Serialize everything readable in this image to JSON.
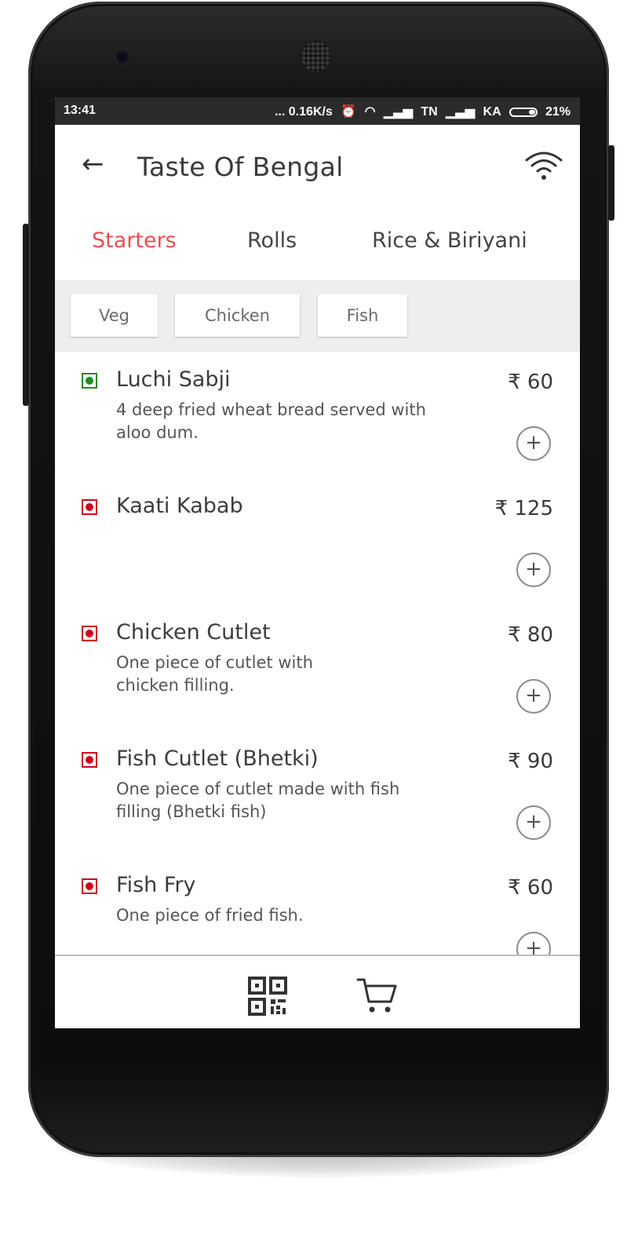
{
  "status_bar": {
    "time": "13:41",
    "speed": "... 0.16K/s",
    "alarm_icon": "alarm-icon",
    "carrier1": "TN",
    "carrier2": "KA",
    "battery": "21%"
  },
  "appbar": {
    "back_icon": "arrow-left-icon",
    "title": "Taste Of Bengal",
    "wifi_icon": "wifi-icon"
  },
  "tabs": [
    {
      "label": "Starters",
      "active": true
    },
    {
      "label": "Rolls",
      "active": false
    },
    {
      "label": "Rice & Biriyani",
      "active": false
    }
  ],
  "filters": [
    {
      "label": "Veg"
    },
    {
      "label": "Chicken"
    },
    {
      "label": "Fish"
    }
  ],
  "items": [
    {
      "name": "Luchi Sabji",
      "description": "4 deep fried wheat bread served with aloo dum.",
      "price": "₹ 60",
      "veg": true
    },
    {
      "name": "Kaati Kabab",
      "description": "",
      "price": "₹ 125",
      "veg": false
    },
    {
      "name": "Chicken Cutlet",
      "description": "One piece of cutlet with chicken filling.",
      "price": "₹ 80",
      "veg": false
    },
    {
      "name": "Fish Cutlet (Bhetki)",
      "description": "One piece of cutlet made with fish filling (Bhetki fish)",
      "price": "₹ 90",
      "veg": false
    },
    {
      "name": "Fish Fry",
      "description": "One piece of fried fish.",
      "price": "₹ 60",
      "veg": false
    }
  ],
  "colors": {
    "accent": "#e8504f",
    "veg": "#1e8c1e",
    "nonveg": "#d0021b"
  },
  "bottom_bar": {
    "qr_icon": "qr-code-icon",
    "cart_icon": "cart-icon"
  }
}
